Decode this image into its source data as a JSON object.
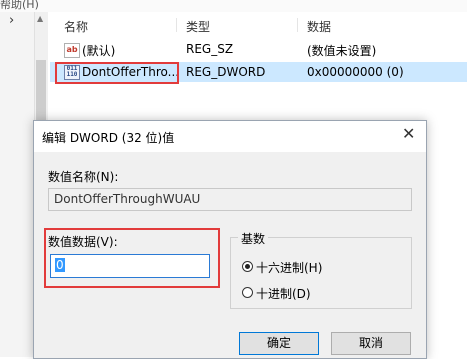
{
  "menu": {
    "help": "帮助(H)"
  },
  "tree": {
    "chevron": "›"
  },
  "list": {
    "headers": {
      "name": "名称",
      "type": "类型",
      "data": "数据"
    },
    "rows": [
      {
        "icon": "string-value-icon",
        "icon_glyph": "ab",
        "name": "(默认)",
        "type": "REG_SZ",
        "data": "(数值未设置)"
      },
      {
        "icon": "dword-value-icon",
        "icon_glyph": "011 110",
        "name": "DontOfferThro...",
        "type": "REG_DWORD",
        "data": "0x00000000 (0)"
      }
    ]
  },
  "dialog": {
    "title": "编辑 DWORD (32 位)值",
    "close": "✕",
    "name_label": "数值名称(N):",
    "name_value": "DontOfferThroughWUAU",
    "data_label": "数值数据(V):",
    "data_value": "0",
    "base": {
      "legend": "基数",
      "options": [
        {
          "label": "十六进制(H)",
          "selected": true
        },
        {
          "label": "十进制(D)",
          "selected": false
        }
      ]
    },
    "ok": "确定",
    "cancel": "取消"
  },
  "colors": {
    "highlight_border": "#e23b3b",
    "selected_row": "#cce8ff",
    "focus_blue": "#0078d7"
  }
}
